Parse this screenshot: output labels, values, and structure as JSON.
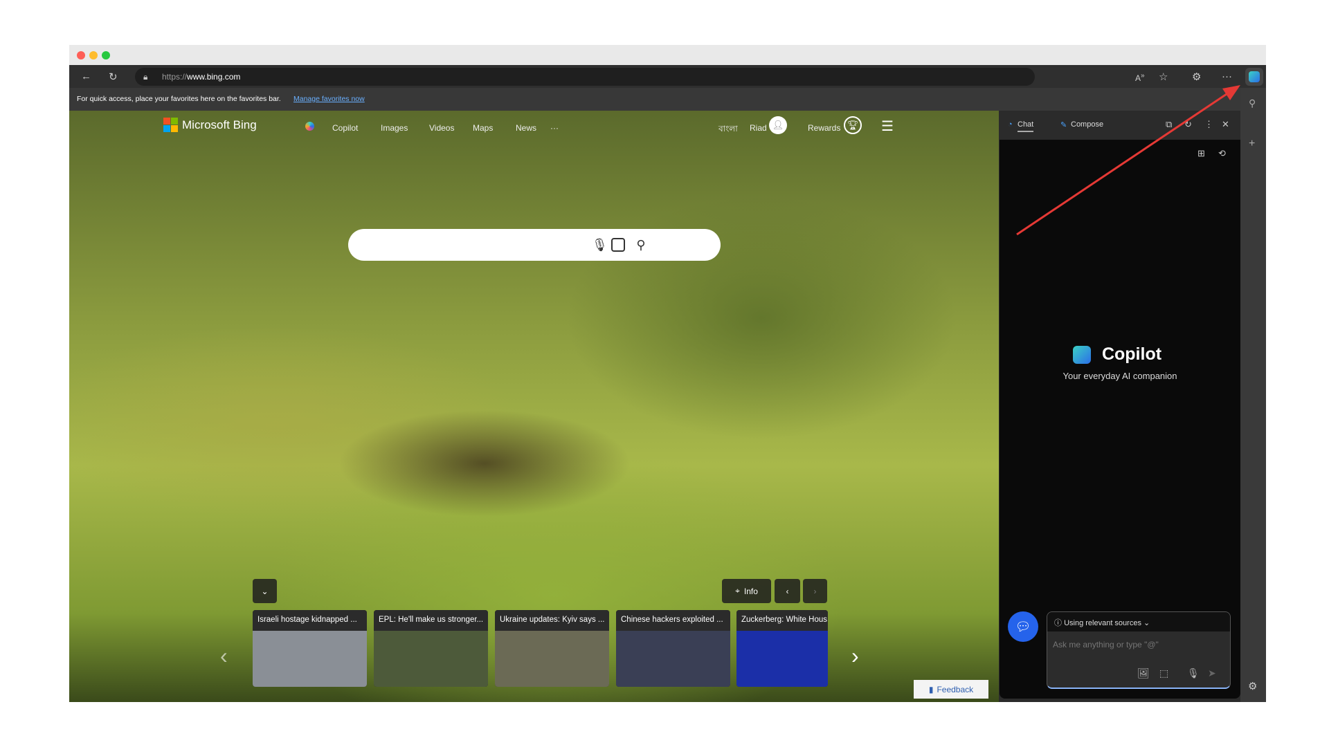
{
  "browser": {
    "url_prefix": "https://",
    "url_host": "www.bing.com",
    "favorites_bar_text": "For quick access, place your favorites here on the favorites bar.",
    "favorites_link": "Manage favorites now",
    "toolbar_icons": [
      "back-icon",
      "reload-icon",
      "lock-icon",
      "read-aloud-icon",
      "favorite-star-icon",
      "extensions-icon",
      "more-icon",
      "copilot-icon"
    ]
  },
  "bing": {
    "logo_text": "Microsoft Bing",
    "nav": [
      "Copilot",
      "Images",
      "Videos",
      "Maps",
      "News",
      "···"
    ],
    "language": "বাংলা",
    "user": "Riad",
    "rewards": "Rewards",
    "search_placeholder": "",
    "info_label": "Info",
    "news": [
      {
        "title": "Israeli hostage kidnapped ...",
        "color": "#8a8f96"
      },
      {
        "title": "EPL: He'll make us stronger...",
        "color": "#4d5a3a"
      },
      {
        "title": "Ukraine updates: Kyiv says ...",
        "color": "#6b6a55"
      },
      {
        "title": "Chinese hackers exploited ...",
        "color": "#3a3f55"
      },
      {
        "title": "Zuckerberg: White Hous",
        "color": "#1b2fa8"
      }
    ],
    "feedback": "Feedback"
  },
  "copilot": {
    "tabs": [
      "Chat",
      "Compose"
    ],
    "title": "Copilot",
    "subtitle": "Your everyday AI companion",
    "sources": "Using relevant sources",
    "input_placeholder": "Ask me anything or type \"@\"",
    "accent": "#2563eb"
  },
  "annotation": {
    "arrow_color": "#e53935"
  }
}
